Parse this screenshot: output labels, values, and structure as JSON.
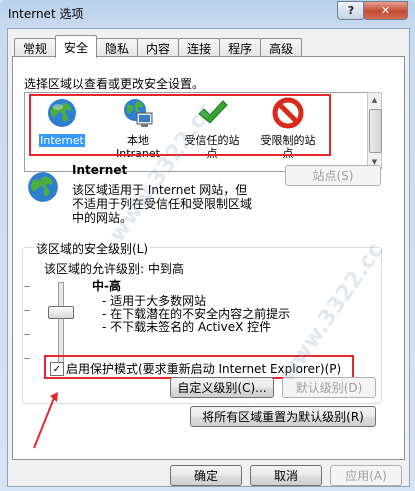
{
  "window": {
    "title": "Internet 选项",
    "help_label": "?",
    "close_label": "✕"
  },
  "tabs": [
    {
      "label": "常规"
    },
    {
      "label": "安全"
    },
    {
      "label": "隐私"
    },
    {
      "label": "内容"
    },
    {
      "label": "连接"
    },
    {
      "label": "程序"
    },
    {
      "label": "高级"
    }
  ],
  "active_tab": "安全",
  "security": {
    "instruction": "选择区域以查看或更改安全设置。",
    "zones": [
      {
        "label": "Internet",
        "icon": "globe-icon",
        "selected": true
      },
      {
        "label_line1": "本地",
        "label_line2": "Intranet",
        "icon": "intranet-icon"
      },
      {
        "label_line1": "受信任的站",
        "label_line2": "点",
        "icon": "checkmark-icon"
      },
      {
        "label_line1": "受限制的站",
        "label_line2": "点",
        "icon": "forbidden-icon"
      }
    ],
    "zone_title": "Internet",
    "zone_desc_line1": "该区域适用于 Internet 网站，但",
    "zone_desc_line2": "不适用于列在受信任和受限制区域",
    "zone_desc_line3": "中的网站。",
    "sites_button": "站点(S)",
    "level_group_title": "该区域的安全级别(L)",
    "allowed_levels": "该区域的允许级别: 中到高",
    "level_name": "中-高",
    "level_bullets": [
      "- 适用于大多数网站",
      "- 在下载潜在的不安全内容之前提示",
      "- 不下载未签名的 ActiveX 控件"
    ],
    "protected_mode_label": "启用保护模式(要求重新启动 Internet Explorer)(P)",
    "protected_mode_checked": true,
    "custom_level_button": "自定义级别(C)...",
    "default_level_button": "默认级别(D)",
    "reset_all_button": "将所有区域重置为默认级别(R)"
  },
  "footer": {
    "ok": "确定",
    "cancel": "取消",
    "apply": "应用(A)"
  },
  "colors": {
    "annotation_red": "#e0282e",
    "selection_blue": "#3399ff"
  },
  "watermark": "www.3322.cc"
}
